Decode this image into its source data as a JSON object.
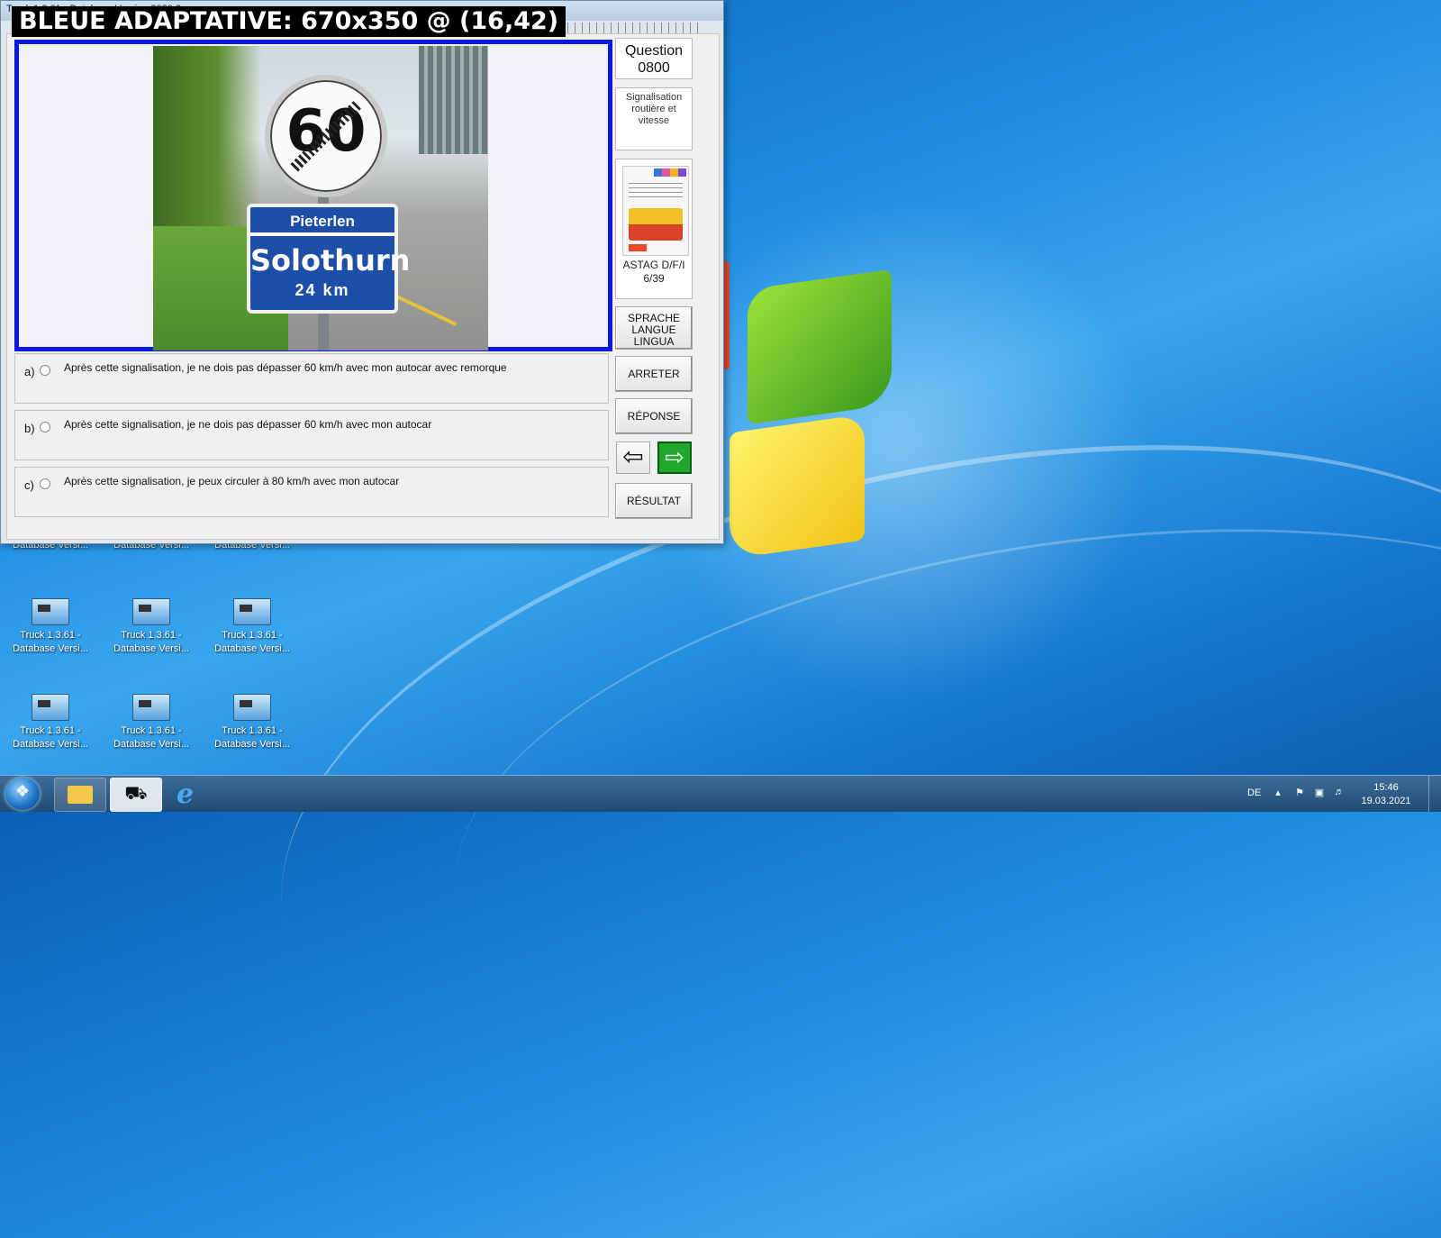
{
  "window": {
    "title": "Truck 1.3.61 - Database Version 2020.2",
    "overlay_label": "BLEUE ADAPTATIVE: 670x350 @ (16,42)"
  },
  "question": {
    "label": "Question",
    "number": "0800",
    "category_line1": "Signalisation",
    "category_line2": "routière et vitesse"
  },
  "sign_photo": {
    "speed": "60",
    "place_top": "Pieterlen",
    "place_main": "Solothurn",
    "distance": "24 km"
  },
  "source": {
    "name": "ASTAG D/F/I",
    "page": "6/39"
  },
  "buttons": {
    "language_l1": "SPRACHE",
    "language_l2": "LANGUE",
    "language_l3": "LINGUA",
    "stop": "ARRETER",
    "answer": "RÉPONSE",
    "result": "RÉSULTAT",
    "prev_icon": "arrow-left-icon",
    "next_icon": "arrow-right-icon"
  },
  "answers": [
    {
      "label": "a)",
      "text": "Après cette signalisation, je ne dois pas dépasser 60 km/h avec mon autocar avec remorque"
    },
    {
      "label": "b)",
      "text": "Après cette signalisation, je ne dois pas dépasser 60 km/h avec mon autocar"
    },
    {
      "label": "c)",
      "text": "Après cette signalisation, je peux circuler à 80 km/h avec mon autocar"
    }
  ],
  "desktop_icons": [
    {
      "line1": "Database Versi..."
    },
    {
      "line1": "Database Versi..."
    },
    {
      "line1": "Database Versi..."
    },
    {
      "line1": "Truck 1.3.61 -",
      "line2": "Database Versi..."
    },
    {
      "line1": "Truck 1.3.61 -",
      "line2": "Database Versi..."
    },
    {
      "line1": "Truck 1.3.61 -",
      "line2": "Database Versi..."
    },
    {
      "line1": "Truck 1.3.61 -",
      "line2": "Database Versi..."
    },
    {
      "line1": "Truck 1.3.61 -",
      "line2": "Database Versi..."
    },
    {
      "line1": "Truck 1.3.61 -",
      "line2": "Database Versi..."
    }
  ],
  "taskbar": {
    "language": "DE",
    "time": "15:46",
    "date": "19.03.2021"
  },
  "colors": {
    "highlight_frame": "#0b18e0",
    "next_button": "#20a82c"
  }
}
